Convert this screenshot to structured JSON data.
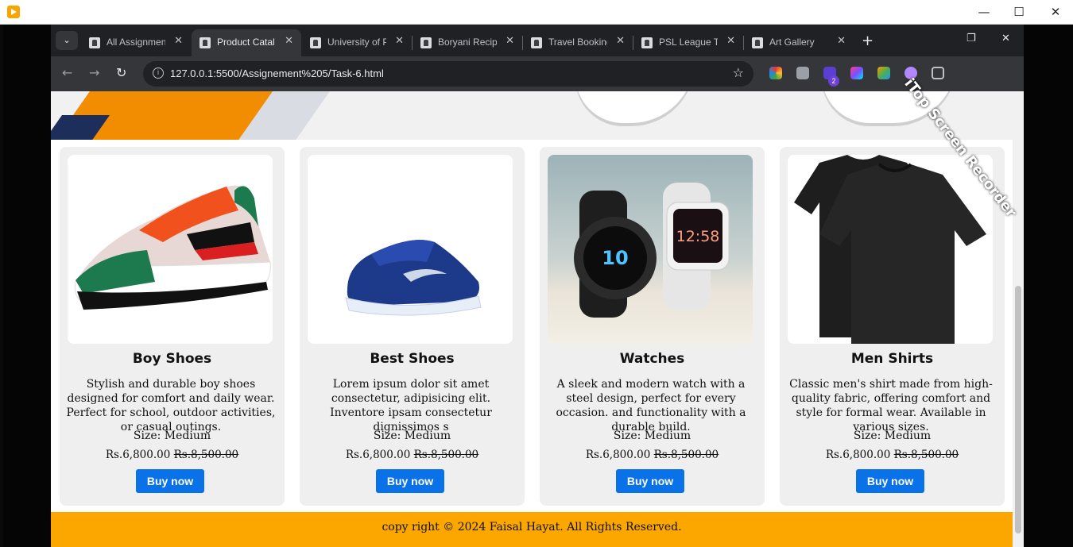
{
  "outer_window": {
    "minimize": "—",
    "maximize": "☐",
    "close": "✕"
  },
  "browser": {
    "tabs": [
      {
        "label": "All Assignmen",
        "active": false
      },
      {
        "label": "Product Catal",
        "active": true
      },
      {
        "label": "University of P",
        "active": false
      },
      {
        "label": "Boryani Recipe",
        "active": false
      },
      {
        "label": "Travel Booking",
        "active": false
      },
      {
        "label": "PSL League Ta",
        "active": false
      },
      {
        "label": "Art Gallery",
        "active": false
      }
    ],
    "new_tab": "+",
    "url": "127.0.0.1:5500/Assignement%205/Task-6.html",
    "extension_badge": "2"
  },
  "products": [
    {
      "title": "Boy Shoes",
      "description": "Stylish and durable boy shoes designed for comfort and daily wear. Perfect for school, outdoor activities, or casual outings.",
      "size": "Size: Medium",
      "price": "Rs.6,800.00",
      "old_price": "Rs.8,500.00",
      "button": "Buy now"
    },
    {
      "title": "Best Shoes",
      "description": "Lorem ipsum dolor sit amet consectetur, adipisicing elit. Inventore ipsam consectetur dignissimos s",
      "size": "Size: Medium",
      "price": "Rs.6,800.00",
      "old_price": "Rs.8,500.00",
      "button": "Buy now"
    },
    {
      "title": "Watches",
      "description": "A sleek and modern watch with a steel design, perfect for every occasion. and functionality with a durable build.",
      "size": "Size: Medium",
      "price": "Rs.6,800.00",
      "old_price": "Rs.8,500.00",
      "button": "Buy now"
    },
    {
      "title": "Men Shirts",
      "description": "Classic men's shirt made from high-quality fabric, offering comfort and style for formal wear. Available in various sizes.",
      "size": "Size: Medium",
      "price": "Rs.6,800.00",
      "old_price": "Rs.8,500.00",
      "button": "Buy now"
    }
  ],
  "watch_display": {
    "left_time": "10",
    "right_time": "12:58"
  },
  "footer": "copy right © 2024 Faisal Hayat. All Rights Reserved.",
  "watermark": "iTop Screen Recorder",
  "colors": {
    "button": "#0a72e8",
    "footer": "#fba700",
    "card": "#efefef"
  }
}
